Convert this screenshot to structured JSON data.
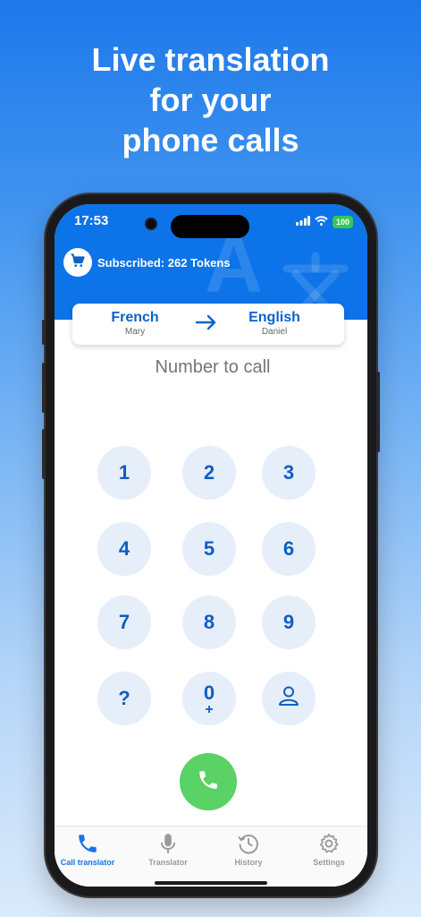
{
  "headline": [
    "Live translation",
    "for your",
    "phone calls"
  ],
  "status_bar": {
    "time": "17:53",
    "battery": "100"
  },
  "header": {
    "subscription_text": "Subscribed: 262 Tokens",
    "cart_icon": "cart-icon"
  },
  "languages": {
    "source": {
      "name": "French",
      "person": "Mary"
    },
    "target": {
      "name": "English",
      "person": "Daniel"
    }
  },
  "number_input": {
    "placeholder": "Number to call",
    "value": ""
  },
  "keypad": {
    "k1": "1",
    "k2": "2",
    "k3": "3",
    "k4": "4",
    "k5": "5",
    "k6": "6",
    "k7": "7",
    "k8": "8",
    "k9": "9",
    "help": "?",
    "k0": "0",
    "k0_sub": "+",
    "contacts_icon": "person-icon"
  },
  "tabs": [
    {
      "label": "Call translator",
      "icon": "phone-icon"
    },
    {
      "label": "Translator",
      "icon": "microphone-icon"
    },
    {
      "label": "History",
      "icon": "history-icon"
    },
    {
      "label": "Settings",
      "icon": "gear-icon"
    }
  ],
  "colors": {
    "accent": "#0d73e8",
    "call_green": "#5ad266",
    "key_bg": "#e6eef9"
  }
}
